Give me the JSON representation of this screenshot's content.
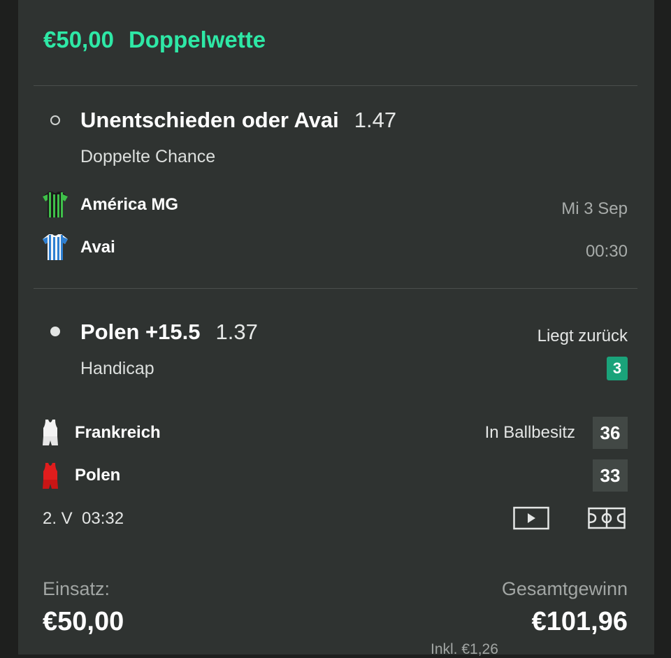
{
  "bet": {
    "stake_amount": "€50,00",
    "bet_type": "Doppelwette"
  },
  "selections": [
    {
      "title": "Unentschieden oder Avai",
      "odds": "1.47",
      "market": "Doppelte Chance",
      "status_icon": "radio-empty-icon",
      "teams": [
        {
          "name": "América MG",
          "jersey": "green-striped-jersey-icon"
        },
        {
          "name": "Avai",
          "jersey": "blue-striped-jersey-icon"
        }
      ],
      "date": "Mi 3 Sep",
      "time": "00:30"
    },
    {
      "title": "Polen +15.5",
      "odds": "1.37",
      "market": "Handicap",
      "status_icon": "radio-filled-icon",
      "status_text": "Liegt zurück",
      "status_badge": "3",
      "possession_text": "In Ballbesitz",
      "teams": [
        {
          "name": "Frankreich",
          "jersey": "white-basketball-jersey-icon",
          "score": "36"
        },
        {
          "name": "Polen",
          "jersey": "red-basketball-jersey-icon",
          "score": "33"
        }
      ],
      "period_clock": "2. V  03:32",
      "actions": [
        "play-video-icon",
        "court-stats-icon"
      ]
    }
  ],
  "footer": {
    "stake_label": "Einsatz:",
    "stake_value": "€50,00",
    "payout_label": "Gesamtgewinn",
    "payout_value": "€101,96",
    "payout_note": "Inkl. €1,26"
  },
  "colors": {
    "accent": "#2ee8a6",
    "card_bg": "#2f3331",
    "page_bg": "#1e1f1e",
    "badge": "#1aa37a",
    "score_box": "#424845"
  }
}
